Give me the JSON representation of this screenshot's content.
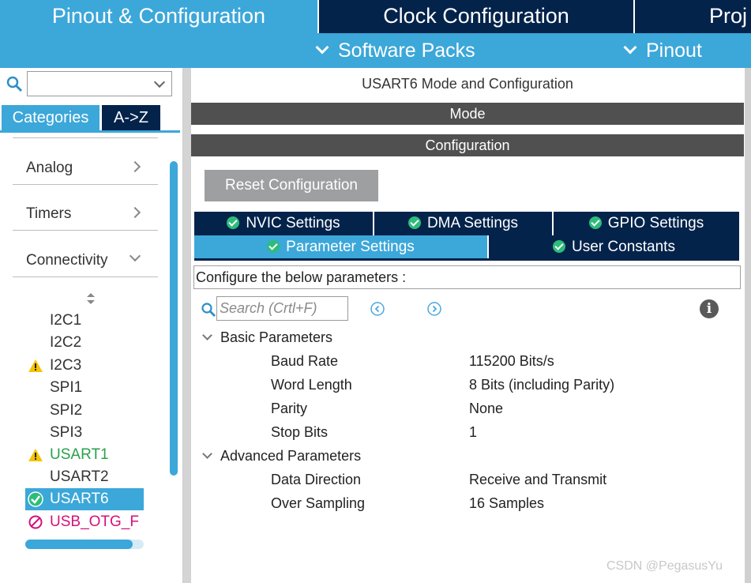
{
  "top_tabs": [
    {
      "label": "Pinout & Configuration",
      "active": true
    },
    {
      "label": "Clock Configuration",
      "active": false
    },
    {
      "label": "Proj",
      "active": false
    }
  ],
  "sub_menu": [
    {
      "label": "Software Packs"
    },
    {
      "label": "Pinout"
    }
  ],
  "left_panel": {
    "search": {
      "value": "",
      "placeholder": ""
    },
    "tabs": [
      {
        "label": "Categories",
        "active": true
      },
      {
        "label": "A->Z",
        "active": false
      }
    ],
    "categories": [
      {
        "label": "Analog",
        "expanded": false
      },
      {
        "label": "Timers",
        "expanded": false
      },
      {
        "label": "Connectivity",
        "expanded": true
      }
    ],
    "peripherals": [
      {
        "label": "I2C1",
        "status": "none"
      },
      {
        "label": "I2C2",
        "status": "none"
      },
      {
        "label": "I2C3",
        "status": "warning"
      },
      {
        "label": "SPI1",
        "status": "none"
      },
      {
        "label": "SPI2",
        "status": "none"
      },
      {
        "label": "SPI3",
        "status": "none"
      },
      {
        "label": "USART1",
        "status": "warning"
      },
      {
        "label": "USART2",
        "status": "none"
      },
      {
        "label": "USART6",
        "status": "ok",
        "selected": true
      },
      {
        "label": "USB_OTG_F",
        "status": "disabled"
      }
    ]
  },
  "right_panel": {
    "title": "USART6 Mode and Configuration",
    "mode_bar": "Mode",
    "config_bar": "Configuration",
    "reset_button": "Reset Configuration",
    "settings_tabs": [
      {
        "label": "NVIC Settings"
      },
      {
        "label": "DMA Settings"
      },
      {
        "label": "GPIO Settings"
      },
      {
        "label": "Parameter Settings",
        "active": true
      },
      {
        "label": "User Constants"
      }
    ],
    "params_title": "Configure the below parameters :",
    "param_search": {
      "placeholder": "Search (Crtl+F)"
    },
    "groups": [
      {
        "label": "Basic Parameters",
        "params": [
          {
            "name": "Baud Rate",
            "value": "115200 Bits/s"
          },
          {
            "name": "Word Length",
            "value": "8 Bits (including Parity)"
          },
          {
            "name": "Parity",
            "value": "None"
          },
          {
            "name": "Stop Bits",
            "value": "1"
          }
        ]
      },
      {
        "label": "Advanced Parameters",
        "params": [
          {
            "name": "Data Direction",
            "value": "Receive and Transmit"
          },
          {
            "name": "Over Sampling",
            "value": "16 Samples"
          }
        ]
      }
    ]
  },
  "watermark": "CSDN @PegasusYu",
  "colors": {
    "accent": "#3ca7d9",
    "navy": "#03234b",
    "bar_gray": "#505050",
    "ok_green": "#2ebc7b",
    "warning_yellow": "#f5c400",
    "disabled_pink": "#d4117a",
    "usart1_green": "#2aa04a"
  }
}
